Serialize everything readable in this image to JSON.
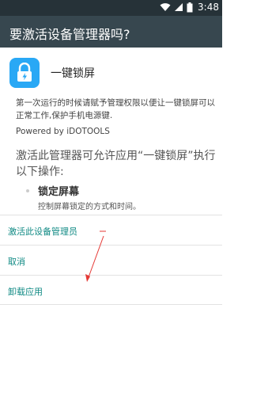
{
  "status_bar": {
    "time": "3:48"
  },
  "app_bar": {
    "title": "要激活设备管理器吗?"
  },
  "app": {
    "name": "一键锁屏"
  },
  "description": "第一次运行的时候请赋予管理权限以便让一键锁屏可以正常工作,保护手机电源键.",
  "powered_by": "Powered by iDOTOOLS",
  "headline": "激活此管理器可允许应用“一键锁屏”执行以下操作:",
  "permission": {
    "title": "锁定屏幕",
    "subtitle": "控制屏幕锁定的方式和时间。"
  },
  "actions": [
    {
      "label": "激活此设备管理员"
    },
    {
      "label": "取消"
    },
    {
      "label": "卸载应用"
    }
  ],
  "colors": {
    "accent": "#108a84",
    "app_bar": "#37474f",
    "status_bar": "#263238",
    "annotation": "#e53935",
    "app_icon": "#29a8f5"
  }
}
